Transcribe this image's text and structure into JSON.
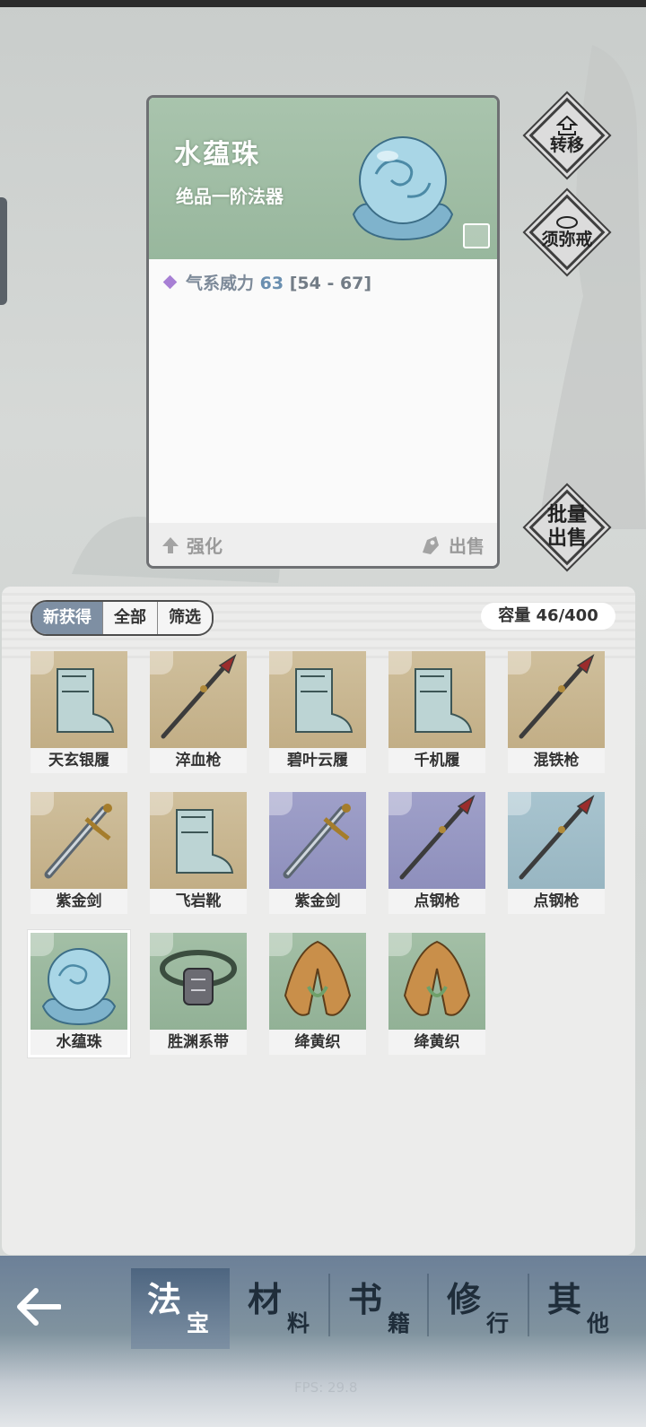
{
  "detail": {
    "title": "水蕴珠",
    "grade": "绝品一阶法器",
    "stat_name": "气系威力",
    "stat_value": "63",
    "stat_range": "[54 - 67]",
    "enhance_label": "强化",
    "sell_label": "出售"
  },
  "side_buttons": {
    "transfer": "转移",
    "ring": "须弥戒",
    "batch_sell_1": "批量",
    "batch_sell_2": "出售"
  },
  "inventory": {
    "tabs": [
      "新获得",
      "全部",
      "筛选"
    ],
    "active_tab": "新获得",
    "capacity": "容量 46/400",
    "items": [
      {
        "name": "天玄银履",
        "bg": "tan",
        "icon": "boots-icon"
      },
      {
        "name": "淬血枪",
        "bg": "tan",
        "icon": "spear-icon"
      },
      {
        "name": "碧叶云履",
        "bg": "tan",
        "icon": "boots-icon"
      },
      {
        "name": "千机履",
        "bg": "tan",
        "icon": "boots-icon"
      },
      {
        "name": "混铁枪",
        "bg": "tan",
        "icon": "spear-icon"
      },
      {
        "name": "紫金剑",
        "bg": "tan",
        "icon": "sword-icon"
      },
      {
        "name": "飞岩靴",
        "bg": "tan",
        "icon": "boots-icon"
      },
      {
        "name": "紫金剑",
        "bg": "purple",
        "icon": "sword-icon"
      },
      {
        "name": "点钢枪",
        "bg": "purple",
        "icon": "spear-icon"
      },
      {
        "name": "点钢枪",
        "bg": "blue",
        "icon": "spear-icon"
      },
      {
        "name": "水蕴珠",
        "bg": "green",
        "icon": "orb-icon"
      },
      {
        "name": "胜渊系带",
        "bg": "green",
        "icon": "belt-icon"
      },
      {
        "name": "绛黄织",
        "bg": "green",
        "icon": "robe-icon"
      },
      {
        "name": "绛黄织",
        "bg": "green",
        "icon": "robe-icon"
      }
    ]
  },
  "nav": [
    {
      "big": "法",
      "small": "宝"
    },
    {
      "big": "材",
      "small": "料"
    },
    {
      "big": "书",
      "small": "籍"
    },
    {
      "big": "修",
      "small": "行"
    },
    {
      "big": "其",
      "small": "他"
    }
  ],
  "fps": "FPS: 29.8"
}
